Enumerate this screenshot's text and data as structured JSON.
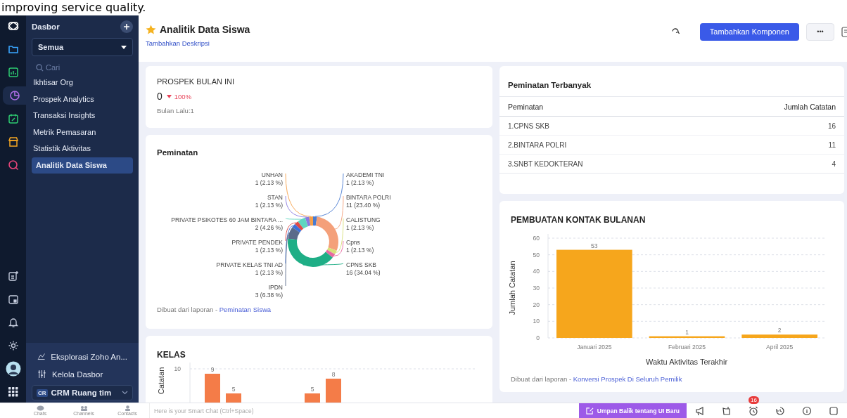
{
  "caption": "improving service quality.",
  "rail": {
    "top": [
      {
        "kind": "logo",
        "selected": false
      },
      {
        "kind": "folder",
        "selected": false
      },
      {
        "kind": "chart",
        "selected": false
      },
      {
        "kind": "pie",
        "selected": true
      },
      {
        "kind": "calendar-edit",
        "selected": false
      },
      {
        "kind": "store",
        "selected": false
      },
      {
        "kind": "search",
        "selected": false
      }
    ],
    "bottom": [
      {
        "kind": "note"
      },
      {
        "kind": "calendar"
      },
      {
        "kind": "bell"
      },
      {
        "kind": "gear"
      },
      {
        "kind": "avatar"
      },
      {
        "kind": "grid"
      }
    ]
  },
  "sidebar": {
    "title": "Dasbor",
    "filter": "Semua",
    "search_placeholder": "Cari",
    "items": [
      {
        "label": "Ikhtisar Org",
        "selected": false
      },
      {
        "label": "Prospek Analytics",
        "selected": false
      },
      {
        "label": "Transaksi Insights",
        "selected": false
      },
      {
        "label": "Metrik Pemasaran",
        "selected": false
      },
      {
        "label": "Statistik Aktivitas",
        "selected": false
      },
      {
        "label": "Analitik Data Siswa",
        "selected": true
      }
    ],
    "footer_links": [
      {
        "kind": "explore",
        "label": "Eksplorasi Zoho An..."
      },
      {
        "kind": "manage",
        "label": "Kelola Dasbor"
      }
    ],
    "workspace": {
      "badge": "CR",
      "label": "CRM Ruang tim"
    }
  },
  "header": {
    "title": "Analitik Data Siswa",
    "description_link": "Tambahkan Deskripsi",
    "primary_button": "Tambahkan Komponen",
    "more_button": "•••"
  },
  "kpi": {
    "title": "PROSPEK BULAN INI",
    "value": "0",
    "change": "100%",
    "negative": true,
    "previous": "Bulan Lalu:1"
  },
  "peminatan": {
    "title": "Peminatan",
    "chart_data": {
      "type": "donut",
      "categories": [
        "UNHAN",
        "STAN",
        "PRIVATE PSIKOTES 60 JAM BINTARA ...",
        "PRIVATE PENDEK",
        "PRIVATE KELAS TNI AD",
        "IPDN",
        "AKADEMI TNI",
        "BINTARA POLRI",
        "CALISTUNG",
        "Cpns",
        "CPNS SKB"
      ],
      "values": [
        1,
        1,
        2,
        1,
        1,
        3,
        1,
        11,
        1,
        1,
        16
      ],
      "value_labels": [
        "1 (2.13 %)",
        "1 (2.13 %)",
        "2 (4.26 %)",
        "1 (2.13 %)",
        "1 (2.13 %)",
        "3 (6.38 %)",
        "1 (2.13 %)",
        "11 (23.40 %)",
        "1 (2.13 %)",
        "1 (2.13 %)",
        "16 (34.04 %)"
      ]
    },
    "source_prefix": "Dibuat dari laporan -",
    "source_link": "Peminatan Siswa"
  },
  "kelas": {
    "title": "KELAS",
    "y_tick": "10",
    "chart_data": {
      "type": "bar",
      "ylabel": "Catatan",
      "series": [
        {
          "color": "#f47c48",
          "values": [
            9,
            5
          ]
        },
        {
          "color": "#f47c48",
          "values": [
            5,
            8
          ]
        }
      ],
      "data_labels": true
    }
  },
  "top_table": {
    "title": "Peminatan Terbanyak",
    "columns": [
      "Peminatan",
      "Jumlah Catatan"
    ],
    "rows": [
      [
        "1.CPNS SKB",
        "16"
      ],
      [
        "2.BINTARA POLRI",
        "11"
      ],
      [
        "3.SNBT KEDOKTERAN",
        "4"
      ]
    ]
  },
  "kontak": {
    "title": "PEMBUATAN KONTAK BULANAN",
    "chart_data": {
      "type": "bar",
      "xlabel": "Waktu Aktivitas Terakhir",
      "ylabel": "Jumlah Catatan",
      "categories": [
        "Januari 2025",
        "Februari 2025",
        "April 2025"
      ],
      "series": [
        {
          "color": "#f6a61c",
          "values": [
            53,
            1,
            2
          ]
        }
      ],
      "ylim": [
        0,
        60
      ],
      "yticks": [
        0,
        10,
        20,
        30,
        40,
        50,
        60
      ],
      "grid": true,
      "data_labels": true
    },
    "source_prefix": "Dibuat dari laporan -",
    "source_link": "Konversi Prospek Di Seluruh Pemilik"
  },
  "bottom_bar": {
    "apps": [
      {
        "kind": "chats",
        "label": "Chats"
      },
      {
        "kind": "channels",
        "label": "Channels"
      },
      {
        "kind": "contacts",
        "label": "Contacts"
      }
    ],
    "smart_chat_placeholder": "Here is your Smart Chat (Ctrl+Space)",
    "feedback_button": "Umpan Balik tentang UI Baru",
    "tools": [
      {
        "kind": "megaphone"
      },
      {
        "kind": "tabs"
      },
      {
        "kind": "alarm",
        "badge": "16"
      },
      {
        "kind": "history"
      },
      {
        "kind": "info"
      },
      {
        "kind": "panel"
      }
    ]
  }
}
